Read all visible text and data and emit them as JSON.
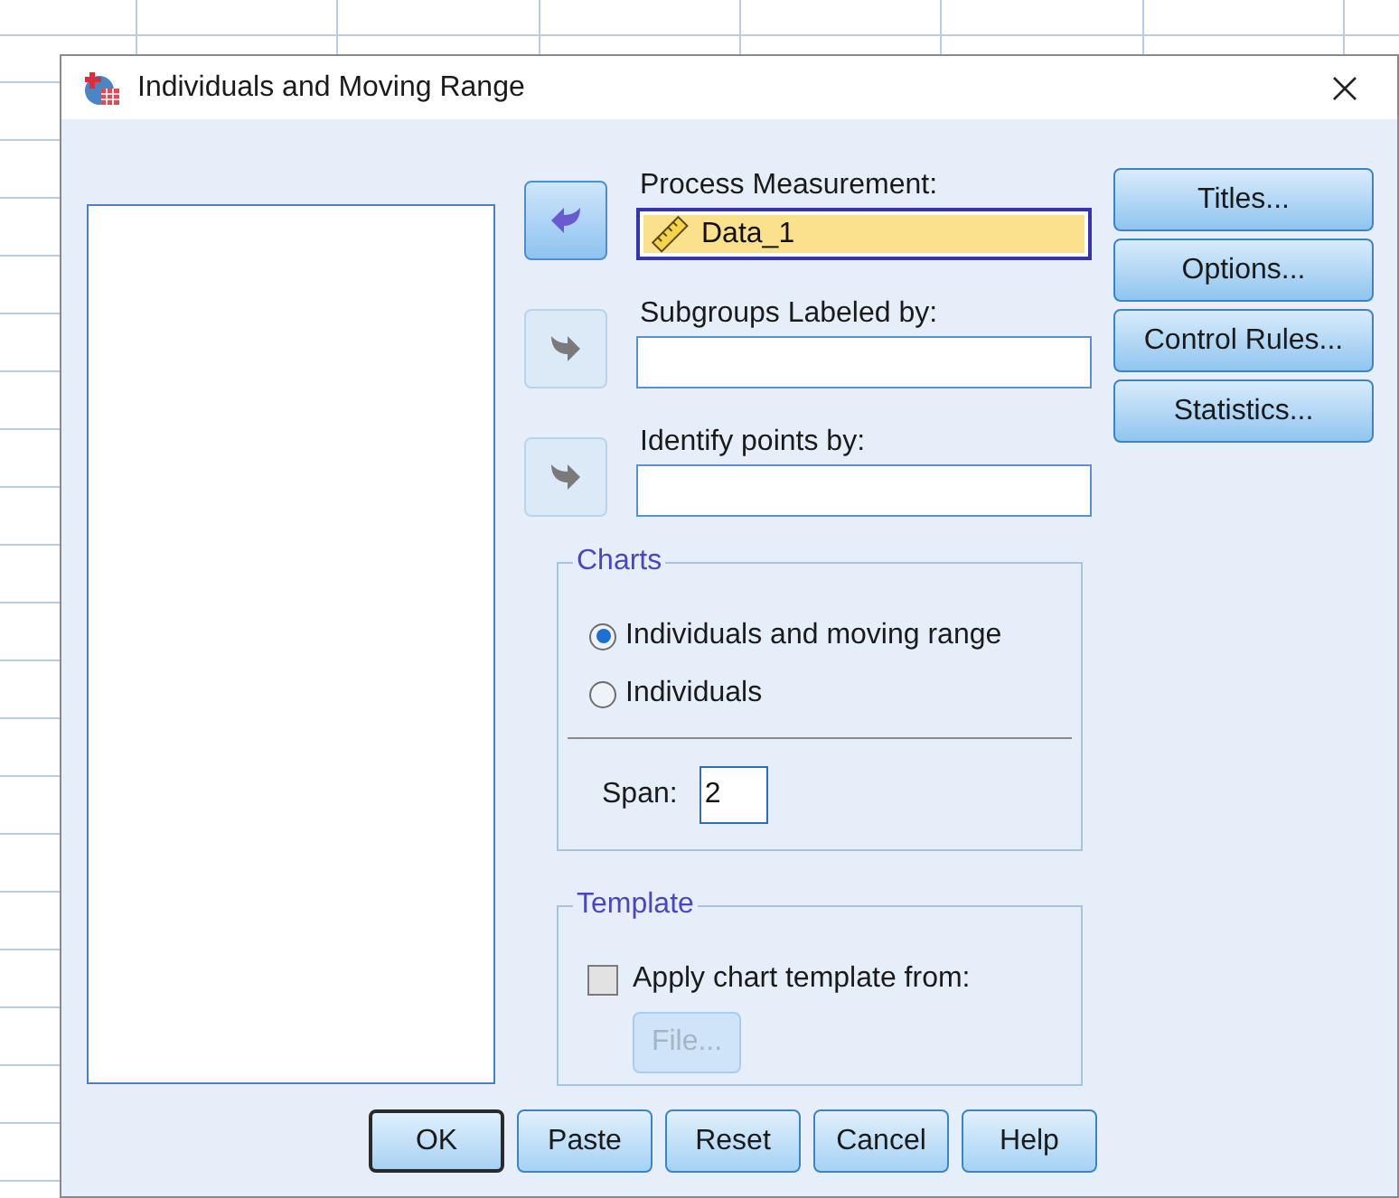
{
  "window": {
    "title": "Individuals and Moving Range"
  },
  "fields": [
    {
      "label": "Process Measurement:",
      "value": "Data_1",
      "selected": true,
      "arrow": {
        "kind": "remove",
        "disabled": false
      }
    },
    {
      "label": "Subgroups Labeled by:",
      "selected": false,
      "arrow": {
        "kind": "add",
        "disabled": true
      }
    },
    {
      "label": "Identify points by:",
      "selected": false,
      "arrow": {
        "kind": "add",
        "disabled": true
      }
    }
  ],
  "side_buttons": [
    "Titles...",
    "Options...",
    "Control Rules...",
    "Statistics..."
  ],
  "charts": {
    "title": "Charts",
    "options": [
      {
        "label": "Individuals and moving range",
        "selected": true
      },
      {
        "label": "Individuals",
        "selected": false
      }
    ],
    "span": {
      "label": "Span:",
      "value": "2"
    }
  },
  "template": {
    "title": "Template",
    "checkbox": {
      "label": "Apply chart template from:",
      "checked": false
    },
    "file_button": {
      "label": "File...",
      "disabled": true
    }
  },
  "buttons": [
    {
      "label": "OK",
      "default": true
    },
    {
      "label": "Paste",
      "default": false
    },
    {
      "label": "Reset",
      "default": false
    },
    {
      "label": "Cancel",
      "default": false
    },
    {
      "label": "Help",
      "default": false
    }
  ]
}
